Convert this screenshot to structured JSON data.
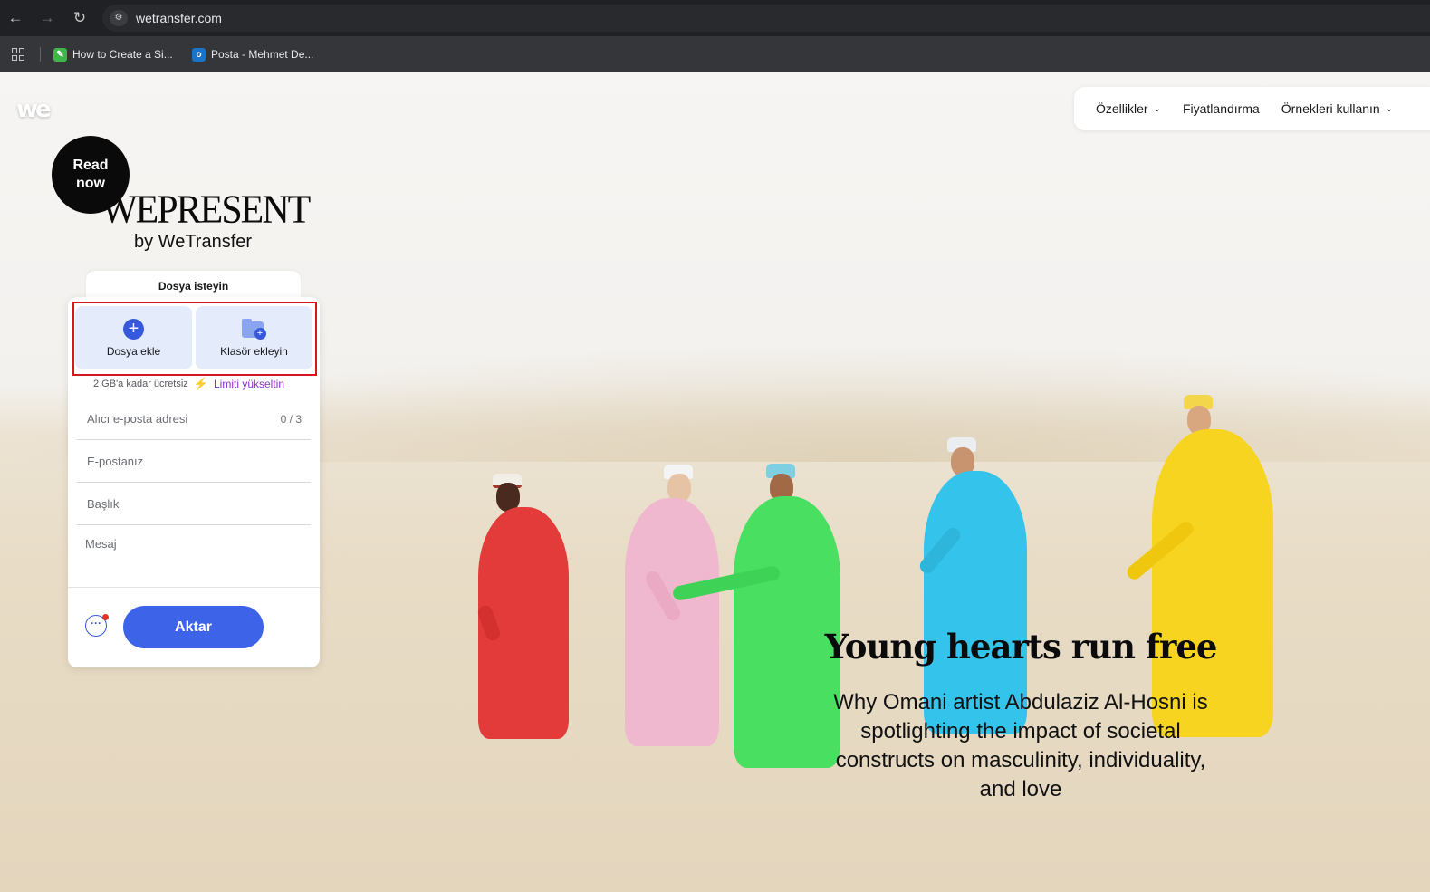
{
  "browser": {
    "url": "wetransfer.com",
    "bookmarks": [
      {
        "label": "How to Create a Si..."
      },
      {
        "label": "Posta - Mehmet De..."
      }
    ]
  },
  "nav": {
    "items": [
      {
        "label": "Özellikler",
        "has_chevron": true
      },
      {
        "label": "Fiyatlandırma",
        "has_chevron": false
      },
      {
        "label": "Örnekleri kullanın",
        "has_chevron": true
      }
    ]
  },
  "promo": {
    "badge": "Read now",
    "brand": "WEPRESENT",
    "brand_sub": "by WeTransfer"
  },
  "transfer": {
    "request_tab": "Dosya isteyin",
    "add_files": "Dosya ekle",
    "add_folder": "Klasör ekleyin",
    "limit_text": "2 GB'a kadar ücretsiz",
    "upgrade_link": "Limiti yükseltin",
    "recipient_placeholder": "Alıcı e-posta adresi",
    "recipient_count": "0 / 3",
    "email_placeholder": "E-postanız",
    "title_placeholder": "Başlık",
    "message_placeholder": "Mesaj",
    "submit_label": "Aktar"
  },
  "hero": {
    "title": "Young hearts run free",
    "subtitle": "Why Omani artist Abdulaziz Al-Hosni is spotlighting the impact of societal constructs on masculinity, individuality, and love"
  },
  "colors": {
    "accent": "#3d64e8",
    "highlight": "#d9141e",
    "upgrade": "#8b2fc9"
  }
}
